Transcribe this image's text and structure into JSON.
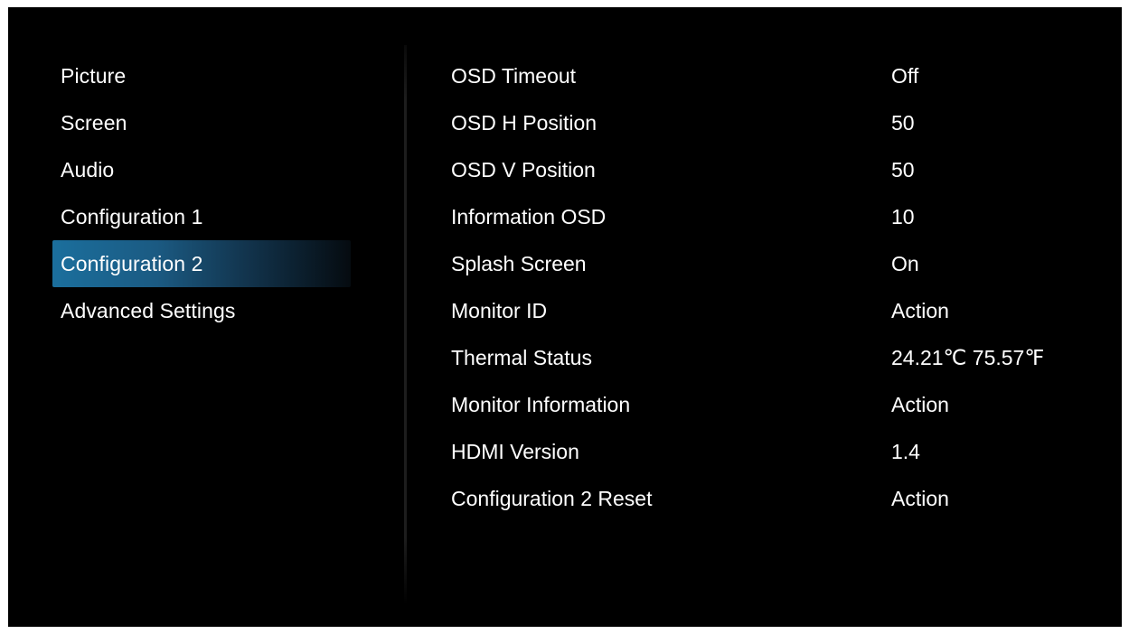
{
  "menu": {
    "items": [
      {
        "label": "Picture",
        "selected": false
      },
      {
        "label": "Screen",
        "selected": false
      },
      {
        "label": "Audio",
        "selected": false
      },
      {
        "label": "Configuration 1",
        "selected": false
      },
      {
        "label": "Configuration 2",
        "selected": true
      },
      {
        "label": "Advanced Settings",
        "selected": false
      }
    ],
    "selected_gradient_colors": [
      "#1b6f9d",
      "#12344d",
      "#050b10"
    ]
  },
  "settings": {
    "rows": [
      {
        "label": "OSD Timeout",
        "value": "Off"
      },
      {
        "label": "OSD H Position",
        "value": "50"
      },
      {
        "label": "OSD V Position",
        "value": "50"
      },
      {
        "label": "Information OSD",
        "value": "10"
      },
      {
        "label": "Splash Screen",
        "value": "On"
      },
      {
        "label": "Monitor ID",
        "value": "Action"
      },
      {
        "label": "Thermal Status",
        "value": "24.21℃ 75.57℉"
      },
      {
        "label": "Monitor Information",
        "value": "Action"
      },
      {
        "label": "HDMI Version",
        "value": "1.4"
      },
      {
        "label": "Configuration 2 Reset",
        "value": "Action"
      }
    ]
  },
  "colors": {
    "background": "#000000",
    "text": "#ffffff",
    "frame": "#ffffff"
  }
}
